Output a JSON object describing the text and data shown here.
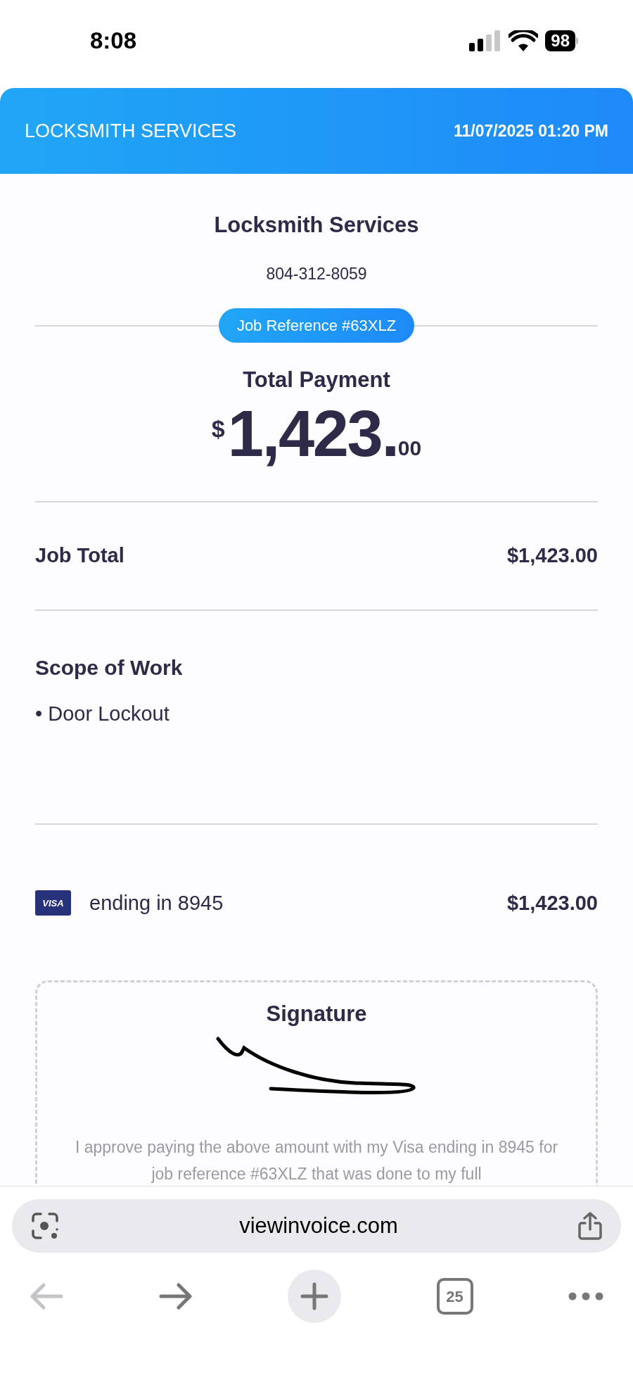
{
  "status_bar": {
    "time": "8:08",
    "battery": "98"
  },
  "header": {
    "title": "LOCKSMITH SERVICES",
    "datetime": "11/07/2025 01:20 PM"
  },
  "business": {
    "name": "Locksmith Services",
    "phone": "804-312-8059"
  },
  "job_reference": "Job Reference #63XLZ",
  "total_payment": {
    "label": "Total Payment",
    "currency": "$",
    "whole": "1,423",
    "decimal_point": ".",
    "cents": "00"
  },
  "job_total": {
    "label": "Job Total",
    "amount": "$1,423.00"
  },
  "scope_of_work": {
    "title": "Scope of Work",
    "items": [
      "Door Lockout"
    ],
    "bullet": "•"
  },
  "payment": {
    "card_brand": "VISA",
    "card_text": "ending in 8945",
    "amount": "$1,423.00"
  },
  "signature": {
    "title": "Signature",
    "approval_text": "I approve paying the above amount with my Visa ending in 8945 for job reference #63XLZ that was done to my full"
  },
  "browser": {
    "url": "viewinvoice.com",
    "tab_count": "25"
  }
}
